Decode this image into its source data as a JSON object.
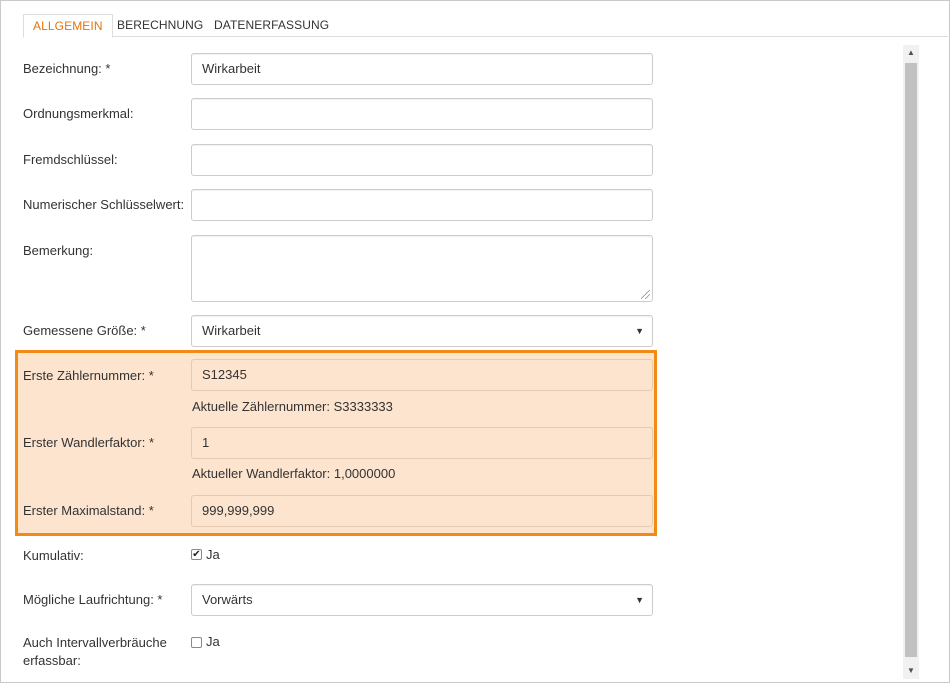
{
  "tabs": {
    "allgemein": "ALLGEMEIN",
    "berechnung": "BERECHNUNG",
    "datenerfassung": "DATENERFASSUNG"
  },
  "accent_color": "#e8730a",
  "highlight_color": "#f28b13",
  "form": {
    "bezeichnung": {
      "label": "Bezeichnung: *",
      "value": "Wirkarbeit"
    },
    "ordnungsmerkmal": {
      "label": "Ordnungsmerkmal:",
      "value": ""
    },
    "fremdschluessel": {
      "label": "Fremdschlüssel:",
      "value": ""
    },
    "numerischer": {
      "label": "Numerischer Schlüsselwert:",
      "value": ""
    },
    "bemerkung": {
      "label": "Bemerkung:",
      "value": ""
    },
    "gemessene": {
      "label": "Gemessene Größe: *",
      "value": "Wirkarbeit"
    },
    "zaehlernummer": {
      "label": "Erste Zählernummer: *",
      "value": "S12345",
      "help": "Aktuelle Zählernummer: S3333333"
    },
    "wandlerfaktor": {
      "label": "Erster Wandlerfaktor: *",
      "value": "1",
      "help": "Aktueller Wandlerfaktor: 1,0000000"
    },
    "maximalstand": {
      "label": "Erster Maximalstand: *",
      "value": "999,999,999"
    },
    "kumulativ": {
      "label": "Kumulativ:",
      "checkbox_label": "Ja",
      "checked": true
    },
    "laufrichtung": {
      "label": "Mögliche Laufrichtung: *",
      "value": "Vorwärts"
    },
    "intervall": {
      "label_line1": "Auch Intervallverbräuche",
      "label_line2": "erfassbar:",
      "checkbox_label": "Ja",
      "checked": false
    }
  },
  "icons": {
    "select_arrow": "▼",
    "scroll_up": "▲",
    "scroll_down": "▼",
    "check": "✔"
  }
}
